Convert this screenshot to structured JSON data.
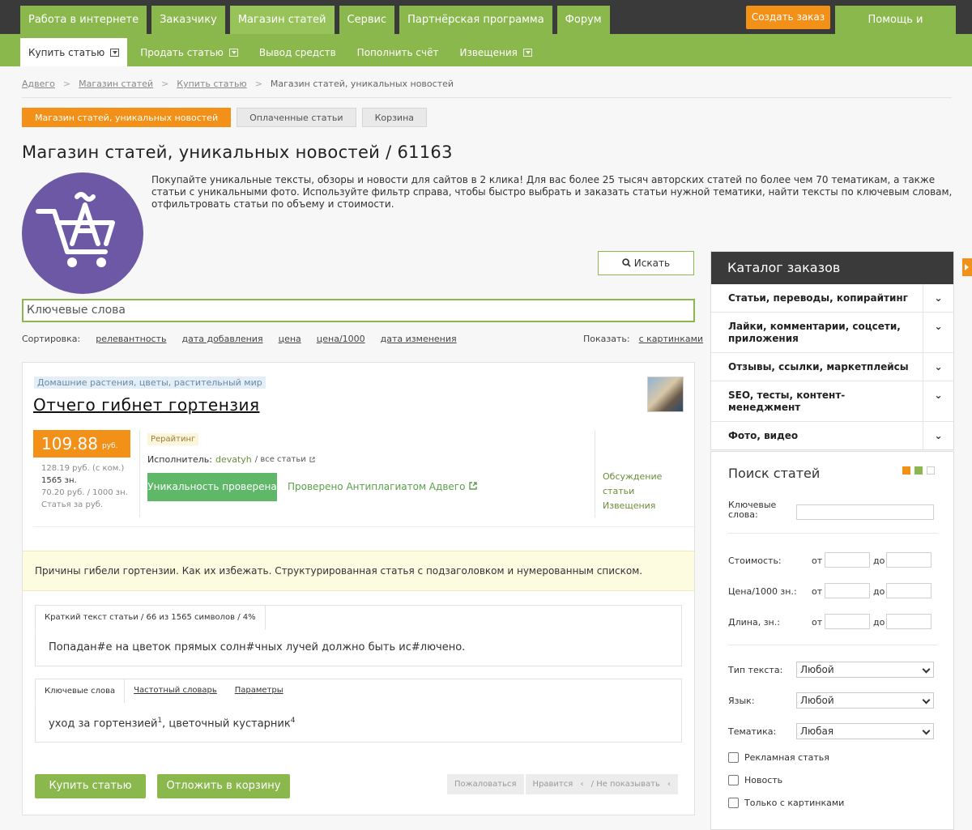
{
  "topnav": {
    "items": [
      "Работа в интернете",
      "Заказчику",
      "Магазин статей",
      "Сервис",
      "Партнёрская программа",
      "Форум"
    ],
    "create_order": "Создать заказ",
    "help": "Помощь и поддержка"
  },
  "subnav": {
    "items": [
      "Купить статью",
      "Продать статью",
      "Вывод средств",
      "Пополнить счёт",
      "Извещения"
    ]
  },
  "breadcrumb": [
    "Адвего",
    "Магазин статей",
    "Купить статью",
    "Магазин статей, уникальных новостей"
  ],
  "tabs": [
    "Магазин статей, уникальных новостей",
    "Оплаченные статьи",
    "Корзина"
  ],
  "page_title": "Магазин статей, уникальных новостей / 61163",
  "intro": "Покупайте уникальные тексты, обзоры и новости для сайтов в 2 клика! Для вас более 25 тысяч авторских статей по более чем 70 тематикам, а также статьи с уникальными фото. Используйте фильтр справа, чтобы быстро выбрать и заказать статьи нужной тематики, найти тексты по ключевым словам, отфильтровать статьи по объему и стоимости.",
  "search": {
    "button": "Искать",
    "placeholder": "Ключевые слова"
  },
  "sort": {
    "label": "Сортировка:",
    "options": [
      "релевантность",
      "дата добавления",
      "цена",
      "цена/1000",
      "дата изменения"
    ],
    "show_label": "Показать:",
    "show_option": "с картинками"
  },
  "article": {
    "category": "Домашние растения, цветы, растительный мир",
    "title": "Отчего гибнет гортензия",
    "price": "109.88",
    "price_unit": "руб.",
    "price_with_commission": "128.19 руб. (с ком.)",
    "length": "1565 зн.",
    "price_per_1000": "70.20 руб. / 1000 зн.",
    "price_label": "Статья за руб.",
    "rerating": "Рерайтинг",
    "executor_label": "Исполнитель:",
    "executor_name": "devatyh",
    "all_articles": "/ все статьи",
    "uniqueness_button": "Уникальность проверена",
    "antiplagiat": "Проверено Антиплагиатом Адвего",
    "discussion": "Обсуждение статьи",
    "notifications": "Извещения",
    "summary": "Причины гибели гортензии. Как их избежать. Структурированная статья с подзаголовком и нумерованным списком.",
    "preview_tab": "Краткий текст статьи / 66 из 1565 символов / 4%",
    "preview_text": "Попадан#е на цветок прямых солн#чных лучей должно быть ис#лючено.",
    "kw_tabs": [
      "Ключевые слова",
      "Частотный словарь",
      "Параметры"
    ],
    "kw_text": "уход за гортензией",
    "kw_sup1": "1",
    "kw_text2": ", цветочный кустарник",
    "kw_sup2": "4",
    "buy_button": "Купить статью",
    "cart_button": "Отложить в корзину",
    "complain": "Пожаловаться",
    "like": "Нравится",
    "hide": "/ Не показывать"
  },
  "catalog": {
    "title": "Каталог заказов",
    "items": [
      "Статьи, переводы, копирайтинг",
      "Лайки, комментарии, соцсети, приложения",
      "Отзывы, ссылки, маркетплейсы",
      "SEO, тесты, контент-менеджмент",
      "Фото, видео"
    ]
  },
  "search_panel": {
    "title": "Поиск статей",
    "keywords_label": "Ключевые слова:",
    "cost_label": "Стоимость:",
    "price1000_label": "Цена/1000 зн.:",
    "length_label": "Длина, зн.:",
    "from": "от",
    "to": "до",
    "text_type_label": "Тип текста:",
    "text_type": "Любой",
    "language_label": "Язык:",
    "language": "Любой",
    "topic_label": "Тематика:",
    "topic": "Любая",
    "check_ad": "Рекламная статья",
    "check_news": "Новость",
    "check_images": "Только с картинками"
  },
  "colors": {
    "accent_green": "#8ab84d",
    "accent_orange": "#f39018",
    "dark": "#3a3a3a",
    "logo_purple": "#6c58a5"
  }
}
